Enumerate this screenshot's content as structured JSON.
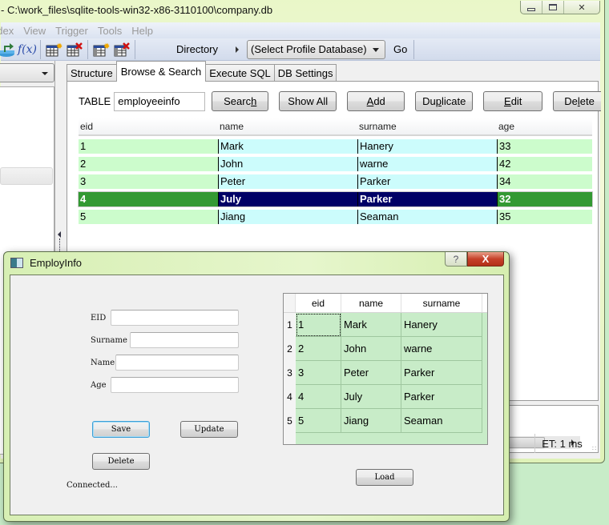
{
  "main_window": {
    "title": "- C:\\work_files\\sqlite-tools-win32-x86-3110100\\company.db",
    "menu": [
      "ndex",
      "View",
      "Trigger",
      "Tools",
      "Help"
    ],
    "toolbar": {
      "icons": [
        "revert-changes-icon",
        "function-icon",
        "create-table-icon",
        "delete-table-icon",
        "create-view-icon",
        "delete-view-icon"
      ],
      "fx_label": "f(x)",
      "directory_label": "Directory",
      "profile_select": "(Select Profile Database)",
      "go_label": "Go"
    },
    "tabs": [
      {
        "label": "Structure",
        "active": false
      },
      {
        "label": "Browse & Search",
        "active": true
      },
      {
        "label": "Execute SQL",
        "active": false
      },
      {
        "label": "DB Settings",
        "active": false
      }
    ],
    "browse": {
      "table_label": "TABLE",
      "table_value": "employeeinfo",
      "buttons": {
        "search_pre": "Searc",
        "search_ul": "h",
        "search_post": "",
        "show_all": "Show All",
        "add_ul": "A",
        "add_post": "dd",
        "dup_pre": "Du",
        "dup_ul": "p",
        "dup_post": "licate",
        "edit_ul": "E",
        "edit_post": "dit",
        "del_pre": "De",
        "del_ul": "l",
        "del_post": "ete"
      },
      "columns": [
        "eid",
        "name",
        "surname",
        "age"
      ],
      "rows": [
        {
          "eid": "1",
          "name": "Mark",
          "surname": "Hanery",
          "age": "33"
        },
        {
          "eid": "2",
          "name": "John",
          "surname": "warne",
          "age": "42"
        },
        {
          "eid": "3",
          "name": "Peter",
          "surname": "Parker",
          "age": "34"
        },
        {
          "eid": "4",
          "name": "July",
          "surname": "Parker",
          "age": "32"
        },
        {
          "eid": "5",
          "name": "Jiang",
          "surname": "Seaman",
          "age": "35"
        }
      ],
      "selected_row": 4
    },
    "status": {
      "elapsed": "ET: 1 ms"
    }
  },
  "dialog": {
    "title": "EmployInfo",
    "help_label": "?",
    "close_label": "X",
    "form": {
      "eid_label": "EID",
      "surname_label": "Surname",
      "name_label": "Name",
      "age_label": "Age",
      "eid_value": "",
      "surname_value": "",
      "name_value": "",
      "age_value": ""
    },
    "buttons": {
      "save": "Save",
      "update": "Update",
      "delete": "Delete",
      "load": "Load"
    },
    "status_text": "Connected...",
    "table": {
      "columns": [
        "eid",
        "name",
        "surname"
      ],
      "rows": [
        {
          "n": "1",
          "eid": "1",
          "name": "Mark",
          "surname": "Hanery"
        },
        {
          "n": "2",
          "eid": "2",
          "name": "John",
          "surname": "warne"
        },
        {
          "n": "3",
          "eid": "3",
          "name": "Peter",
          "surname": "Parker"
        },
        {
          "n": "4",
          "eid": "4",
          "name": "July",
          "surname": "Parker"
        },
        {
          "n": "5",
          "eid": "5",
          "name": "Jiang",
          "surname": "Seaman"
        }
      ]
    }
  },
  "colors": {
    "row_green": "#ccfccc",
    "row_cyan": "#ccfcfc",
    "selected_green": "#339933",
    "selected_navy": "#000066",
    "dialog_table_bg": "#c8ecc8"
  }
}
